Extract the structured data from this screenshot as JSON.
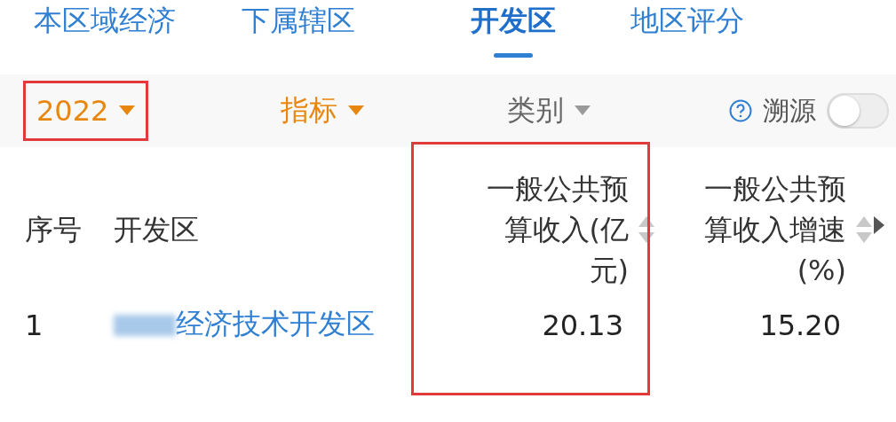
{
  "tabs": [
    {
      "label": "本区域经济",
      "selected": false
    },
    {
      "label": "下属辖区",
      "selected": false
    },
    {
      "label": "开发区",
      "selected": true
    },
    {
      "label": "地区评分",
      "selected": false
    }
  ],
  "filters": [
    {
      "label": "2022",
      "active": true,
      "highlighted": true
    },
    {
      "label": "指标",
      "active": true,
      "highlighted": false
    },
    {
      "label": "类别",
      "active": false,
      "highlighted": false
    }
  ],
  "source_toggle": {
    "label": "溯源",
    "on": false
  },
  "table": {
    "columns": [
      {
        "label": "序号",
        "sortable": false,
        "highlighted": false
      },
      {
        "label": "开发区",
        "sortable": false,
        "highlighted": false
      },
      {
        "label": "一般公共预算收入(亿元)",
        "sortable": true,
        "highlighted": true
      },
      {
        "label": "一般公共预算收入增速(%)",
        "sortable": true,
        "highlighted": false
      }
    ],
    "rows": [
      {
        "cells": [
          "1",
          "经济技术开发区",
          "20.13",
          "15.20"
        ]
      }
    ]
  }
}
